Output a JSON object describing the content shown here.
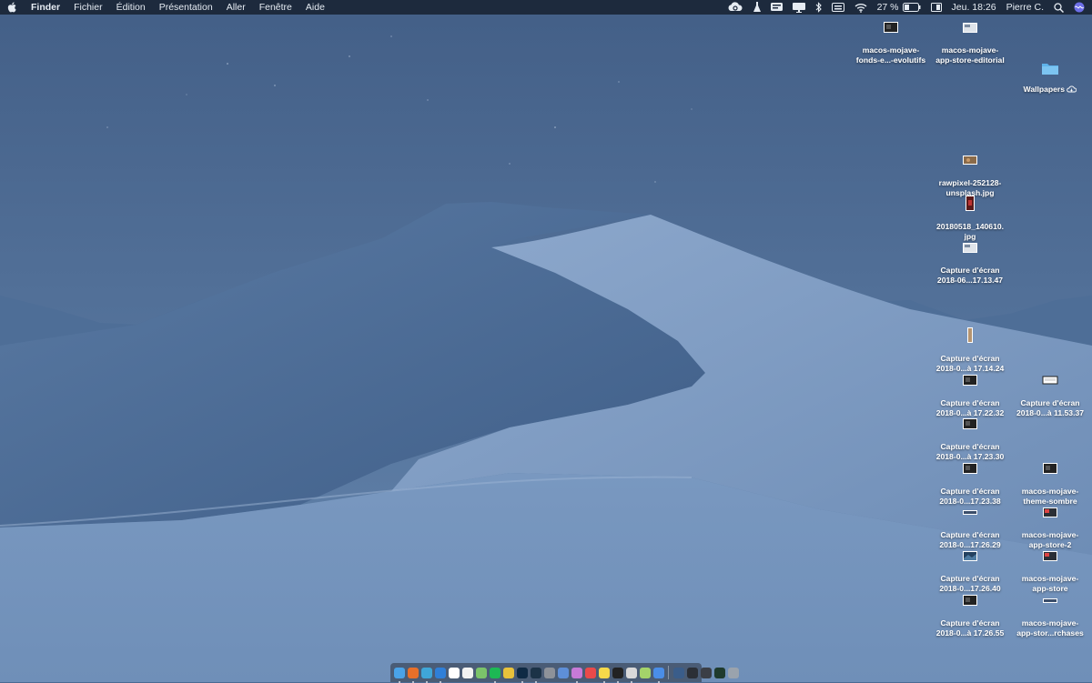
{
  "menubar": {
    "app_name": "Finder",
    "menus": [
      "Fichier",
      "Édition",
      "Présentation",
      "Aller",
      "Fenêtre",
      "Aide"
    ],
    "status": {
      "battery_percent": "27 %",
      "clock": "Jeu. 18:26",
      "user": "Pierre C."
    },
    "status_icons": [
      "creative-cloud-icon",
      "flask-icon",
      "notification-icon",
      "display-mirroring-icon",
      "bluetooth-icon",
      "keyboard-icon",
      "wifi-icon",
      "battery-icon",
      "input-source-icon",
      "spotlight-icon",
      "siri-icon"
    ]
  },
  "desktop": {
    "icons": [
      {
        "line1": "macos-mojave-",
        "line2": "fonds-e...-evolutifs",
        "kind": "screenshot-dark"
      },
      {
        "line1": "macos-mojave-",
        "line2": "app-store-editorial",
        "kind": "screenshot-light"
      },
      {
        "line1": "Wallpapers",
        "line2": "",
        "kind": "folder",
        "cloud": true
      },
      {
        "line1": "rawpixel-252128-",
        "line2": "unsplash.jpg",
        "kind": "photo"
      },
      {
        "line1": "20180518_140610.",
        "line2": "jpg",
        "kind": "photo-red"
      },
      {
        "line1": "Capture d'écran",
        "line2": "2018-06...17.13.47",
        "kind": "screenshot-light"
      },
      {
        "line1": "Capture d'écran",
        "line2": "2018-0...à 17.14.24",
        "kind": "portrait"
      },
      {
        "line1": "Capture d'écran",
        "line2": "2018-0...à 17.22.32",
        "kind": "screenshot-dark"
      },
      {
        "line1": "Capture d'écran",
        "line2": "2018-0...à 11.53.37",
        "kind": "screenshot-white"
      },
      {
        "line1": "Capture d'écran",
        "line2": "2018-0...à 17.23.30",
        "kind": "screenshot-dark"
      },
      {
        "line1": "Capture d'écran",
        "line2": "2018-0...17.23.38",
        "kind": "screenshot-dark"
      },
      {
        "line1": "macos-mojave-",
        "line2": "theme-sombre",
        "kind": "screenshot-dark"
      },
      {
        "line1": "Capture d'écran",
        "line2": "2018-0...17.26.29",
        "kind": "banner"
      },
      {
        "line1": "macos-mojave-",
        "line2": "app-store-2",
        "kind": "screenshot-red"
      },
      {
        "line1": "Capture d'écran",
        "line2": "2018-0...17.26.40",
        "kind": "landscape"
      },
      {
        "line1": "macos-mojave-",
        "line2": "app-store",
        "kind": "screenshot-red"
      },
      {
        "line1": "Capture d'écran",
        "line2": "2018-0...à 17.26.55",
        "kind": "screenshot-dark"
      },
      {
        "line1": "macos-mojave-",
        "line2": "app-stor...rchases",
        "kind": "banner"
      }
    ]
  },
  "dock": {
    "apps": [
      {
        "name": "finder",
        "color": "#4aa3e8"
      },
      {
        "name": "firefox",
        "color": "#e8702a"
      },
      {
        "name": "chrome",
        "color": "#3fa6d8"
      },
      {
        "name": "safari",
        "color": "#2f7fd8"
      },
      {
        "name": "app-store",
        "color": "#ffffff"
      },
      {
        "name": "calendar",
        "color": "#f2f2f2"
      },
      {
        "name": "maps",
        "color": "#7bc36a"
      },
      {
        "name": "spotify",
        "color": "#1db954"
      },
      {
        "name": "transmit",
        "color": "#e9c23b"
      },
      {
        "name": "photoshop",
        "color": "#0f2a44"
      },
      {
        "name": "lightroom",
        "color": "#1c3347"
      },
      {
        "name": "system-preferences",
        "color": "#8e9299"
      },
      {
        "name": "simulator",
        "color": "#5e8fd8"
      },
      {
        "name": "itunes",
        "color": "#c77ad8"
      },
      {
        "name": "photos",
        "color": "#ea4a4a"
      },
      {
        "name": "notes",
        "color": "#f6d94a"
      },
      {
        "name": "terminal",
        "color": "#222222"
      },
      {
        "name": "preview",
        "color": "#d9d9d9"
      },
      {
        "name": "activity-monitor",
        "color": "#a4d36a"
      },
      {
        "name": "xcode",
        "color": "#4a8ee8"
      }
    ],
    "docs": [
      {
        "name": "downloads-stack",
        "color": "#3a5d8a"
      },
      {
        "name": "recent-doc-1",
        "color": "#2b2f36"
      },
      {
        "name": "recent-doc-2",
        "color": "#3b3f46"
      },
      {
        "name": "recent-doc-3",
        "color": "#1f3b2e"
      },
      {
        "name": "trash",
        "color": "#9aa3ad"
      }
    ]
  }
}
